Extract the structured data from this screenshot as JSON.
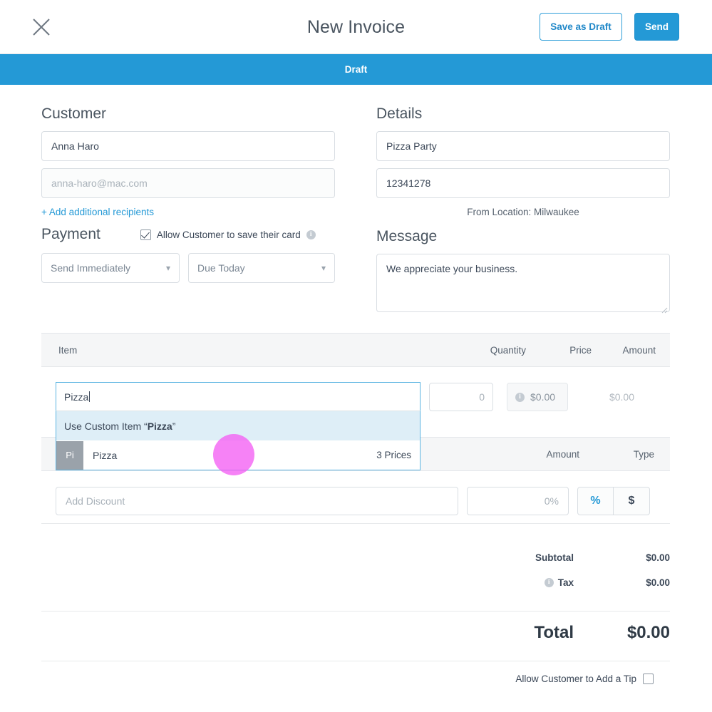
{
  "header": {
    "close_icon": "close-icon",
    "title": "New Invoice",
    "save_draft_label": "Save as Draft",
    "send_label": "Send",
    "accent_color": "#2499d6"
  },
  "status": {
    "label": "Draft",
    "background": "#2499d6"
  },
  "customer": {
    "heading": "Customer",
    "name_value": "Anna Haro",
    "email_placeholder": "anna-haro@mac.com",
    "add_recipients_label": "+ Add additional recipients"
  },
  "payment": {
    "heading": "Payment",
    "save_card_label": "Allow Customer to save their card",
    "save_card_checked": true,
    "info_icon": "info-icon",
    "schedule_value": "Send Immediately",
    "due_value": "Due Today"
  },
  "details": {
    "heading": "Details",
    "title_value": "Pizza Party",
    "number_value": "12341278",
    "location_label": "From Location: Milwaukee"
  },
  "message": {
    "heading": "Message",
    "value": "We appreciate your business."
  },
  "items_table": {
    "columns": {
      "item": "Item",
      "quantity": "Quantity",
      "price": "Price",
      "amount": "Amount"
    },
    "row": {
      "quantity_placeholder": "0",
      "price_value": "$0.00",
      "price_info_icon": "info-icon",
      "amount_value": "$0.00"
    }
  },
  "autocomplete": {
    "query": "Pizza",
    "custom_prefix": "Use Custom Item “",
    "custom_term": "Pizza",
    "custom_suffix": "”",
    "result_thumb": "Pi",
    "result_name": "Pizza",
    "result_meta": "3 Prices"
  },
  "discount_table": {
    "columns": {
      "amount": "Amount",
      "type": "Type"
    },
    "input_placeholder": "Add Discount",
    "percent_placeholder": "0%",
    "toggle_percent": "%",
    "toggle_dollar": "$",
    "toggle_selected": "%"
  },
  "totals": {
    "subtotal_label": "Subtotal",
    "subtotal_value": "$0.00",
    "tax_label": "Tax",
    "tax_value": "$0.00",
    "tax_info_icon": "info-icon",
    "total_label": "Total",
    "total_value": "$0.00"
  },
  "tip": {
    "label": "Allow Customer to Add a Tip",
    "checked": false
  }
}
